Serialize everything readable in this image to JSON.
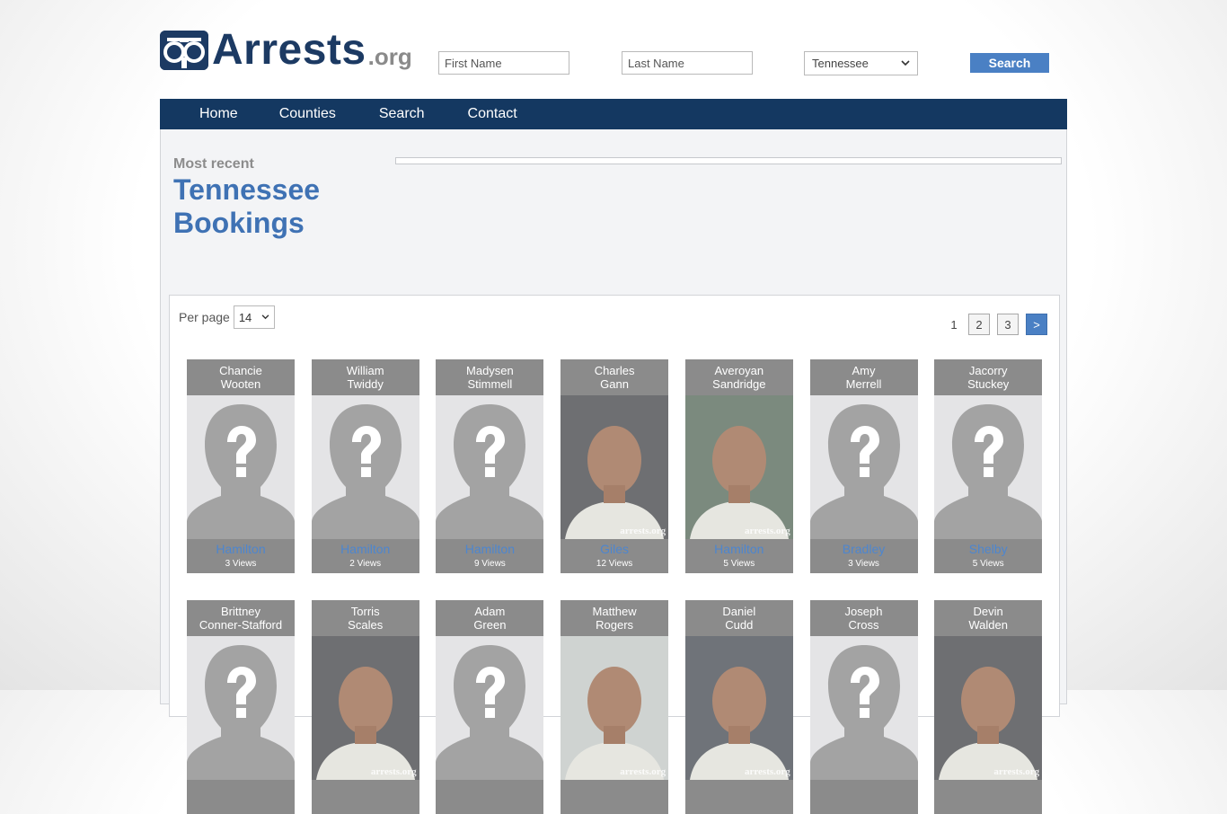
{
  "logo": {
    "name": "Arrests",
    "suffix": ".org"
  },
  "header": {
    "first_name_placeholder": "First Name",
    "last_name_placeholder": "Last Name",
    "state_selected": "Tennessee",
    "search_label": "Search"
  },
  "nav": {
    "items": [
      "Home",
      "Counties",
      "Search",
      "Contact"
    ]
  },
  "heading": {
    "sub": "Most recent",
    "title": "Tennessee Bookings"
  },
  "listing": {
    "per_page_label": "Per page",
    "per_page_value": "14",
    "pages": [
      "1",
      "2",
      "3"
    ],
    "next_label": ">"
  },
  "bookings": [
    {
      "first": "Chancie",
      "last": "Wooten",
      "county": "Hamilton",
      "views": "3 Views",
      "photo": "placeholder"
    },
    {
      "first": "William",
      "last": "Twiddy",
      "county": "Hamilton",
      "views": "2 Views",
      "photo": "placeholder"
    },
    {
      "first": "Madysen",
      "last": "Stimmell",
      "county": "Hamilton",
      "views": "9 Views",
      "photo": "placeholder"
    },
    {
      "first": "Charles",
      "last": "Gann",
      "county": "Giles",
      "views": "12 Views",
      "photo": "mugshot"
    },
    {
      "first": "Averoyan",
      "last": "Sandridge",
      "county": "Hamilton",
      "views": "5 Views",
      "photo": "mugshot"
    },
    {
      "first": "Amy",
      "last": "Merrell",
      "county": "Bradley",
      "views": "3 Views",
      "photo": "placeholder"
    },
    {
      "first": "Jacorry",
      "last": "Stuckey",
      "county": "Shelby",
      "views": "5 Views",
      "photo": "placeholder"
    },
    {
      "first": "Brittney",
      "last": "Conner-Stafford",
      "county": "",
      "views": "",
      "photo": "placeholder"
    },
    {
      "first": "Torris",
      "last": "Scales",
      "county": "",
      "views": "",
      "photo": "mugshot"
    },
    {
      "first": "Adam",
      "last": "Green",
      "county": "",
      "views": "",
      "photo": "placeholder"
    },
    {
      "first": "Matthew",
      "last": "Rogers",
      "county": "",
      "views": "",
      "photo": "mugshot"
    },
    {
      "first": "Daniel",
      "last": "Cudd",
      "county": "",
      "views": "",
      "photo": "mugshot"
    },
    {
      "first": "Joseph",
      "last": "Cross",
      "county": "",
      "views": "",
      "photo": "placeholder"
    },
    {
      "first": "Devin",
      "last": "Walden",
      "county": "",
      "views": "",
      "photo": "mugshot"
    }
  ],
  "watermark": "arrests.org"
}
